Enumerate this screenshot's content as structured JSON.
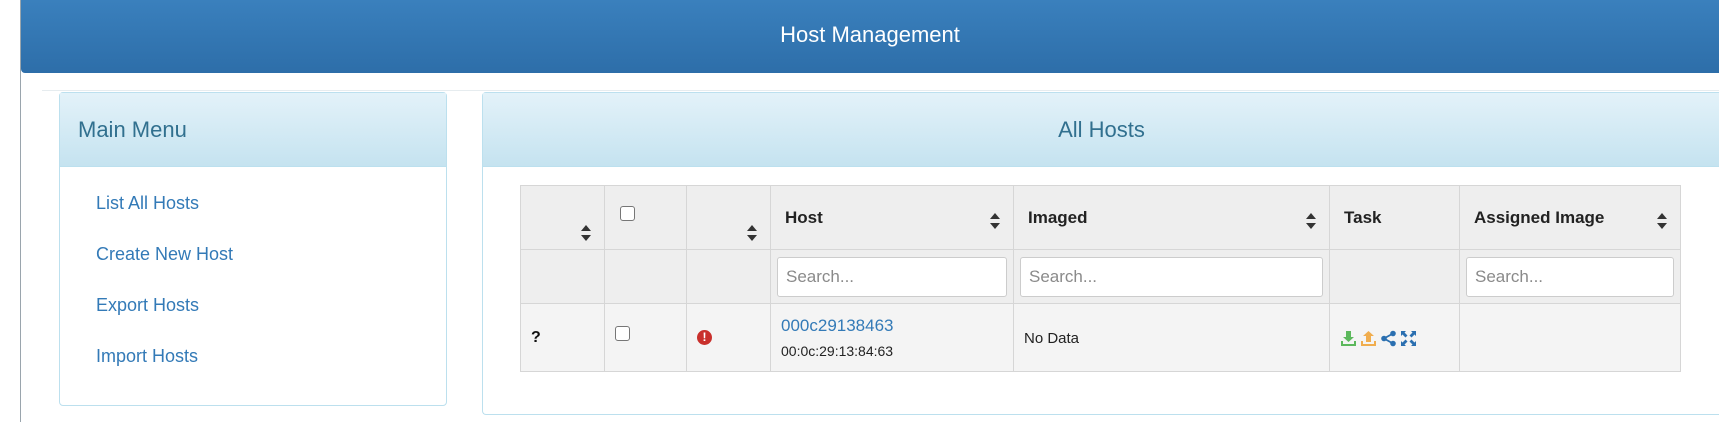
{
  "header": {
    "title": "Host Management"
  },
  "main_menu": {
    "title": "Main Menu",
    "items": [
      {
        "label": "List All Hosts"
      },
      {
        "label": "Create New Host"
      },
      {
        "label": "Export Hosts"
      },
      {
        "label": "Import Hosts"
      }
    ]
  },
  "hosts_panel": {
    "title": "All Hosts",
    "columns": {
      "host": "Host",
      "imaged": "Imaged",
      "task": "Task",
      "assigned_image": "Assigned Image"
    },
    "filters": {
      "host_placeholder": "Search...",
      "imaged_placeholder": "Search...",
      "assigned_image_placeholder": "Search..."
    },
    "rows": [
      {
        "status": "?",
        "alert": "!",
        "host_name": "000c29138463",
        "mac": "00:0c:29:13:84:63",
        "imaged": "No Data",
        "assigned_image": "",
        "task_icons": [
          "deploy-icon",
          "capture-icon",
          "multicast-icon",
          "advanced-icon"
        ]
      }
    ]
  },
  "colors": {
    "header_blue": "#2d6ea9",
    "link_blue": "#337ab7",
    "panel_title": "#31708f",
    "alert_red": "#c9302c",
    "deploy_green": "#5cb85c",
    "capture_orange": "#f0ad4e",
    "task_blue": "#2a6fb0"
  }
}
